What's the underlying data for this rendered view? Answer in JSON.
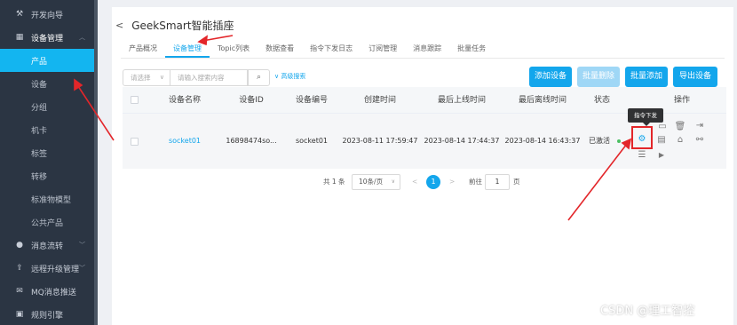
{
  "sidebar": {
    "top_items": [
      {
        "label": "开发向导",
        "icon": "wand-icon"
      },
      {
        "label": "设备管理",
        "icon": "grid-icon"
      }
    ],
    "sub_items": [
      {
        "label": "产品"
      },
      {
        "label": "设备"
      },
      {
        "label": "分组"
      },
      {
        "label": "机卡"
      },
      {
        "label": "标签"
      },
      {
        "label": "转移"
      },
      {
        "label": "标准物模型"
      },
      {
        "label": "公共产品"
      }
    ],
    "bottom_items": [
      {
        "label": "消息流转",
        "icon": "flow-icon"
      },
      {
        "label": "远程升级管理",
        "icon": "upgrade-icon"
      },
      {
        "label": "MQ消息推送",
        "icon": "message-icon"
      },
      {
        "label": "规则引擎",
        "icon": "rule-icon"
      }
    ]
  },
  "header": {
    "title": "GeekSmart智能插座"
  },
  "tabs": [
    "产品概况",
    "设备管理",
    "Topic列表",
    "数据查看",
    "指令下发日志",
    "订阅管理",
    "消息跟踪",
    "批量任务"
  ],
  "filter": {
    "select_placeholder": "请选择",
    "input_placeholder": "请输入搜索内容",
    "advanced_label": "高级搜索"
  },
  "buttons": {
    "add_device": "添加设备",
    "batch_delete": "批量删除",
    "batch_add": "批量添加",
    "export_device": "导出设备"
  },
  "table": {
    "columns": [
      "设备名称",
      "设备ID",
      "设备编号",
      "创建时间",
      "最后上线时间",
      "最后离线时间",
      "状态",
      "操作"
    ],
    "rows": [
      {
        "name": "socket01",
        "id": "16898474so...",
        "code": "socket01",
        "created": "2023-08-11 17:59:47",
        "last_online": "2023-08-14 17:44:37",
        "last_offline": "2023-08-14 16:43:37",
        "status": "已激活"
      }
    ]
  },
  "tooltip": "指令下发",
  "pagination": {
    "total": "共 1 条",
    "page_size": "10条/页",
    "current_page": "1",
    "goto_label": "前往",
    "goto_value": "1",
    "page_suffix": "页"
  },
  "watermark": "CSDN @理工智控",
  "colors": {
    "accent": "#13a6ec",
    "sidebar_bg": "#2b3543",
    "annotation": "#e3262a"
  }
}
